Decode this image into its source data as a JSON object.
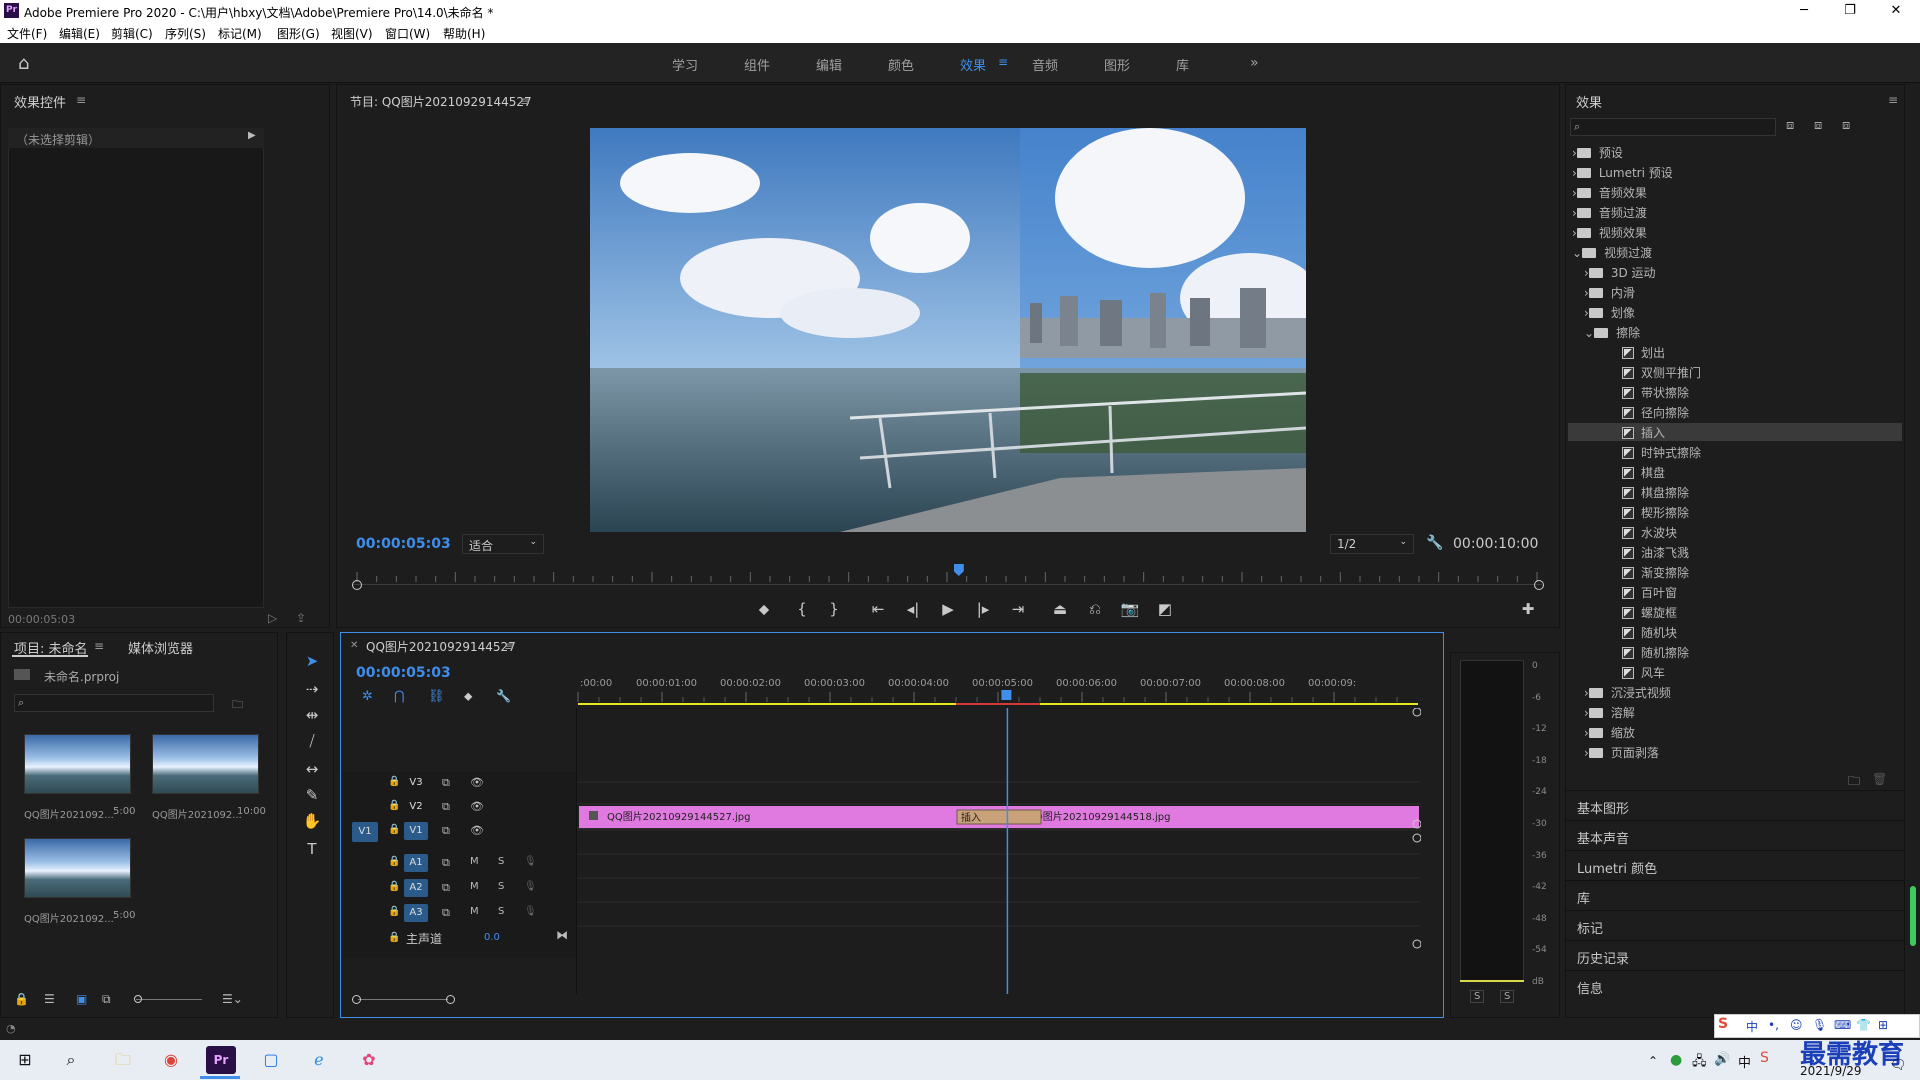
{
  "window": {
    "title": "Adobe Premiere Pro 2020 - C:\\用户\\hbxy\\文档\\Adobe\\Premiere Pro\\14.0\\未命名 *",
    "logo": "Pr"
  },
  "menu": [
    "文件(F)",
    "编辑(E)",
    "剪辑(C)",
    "序列(S)",
    "标记(M)",
    "图形(G)",
    "视图(V)",
    "窗口(W)",
    "帮助(H)"
  ],
  "workspaces": [
    "学习",
    "组件",
    "编辑",
    "颜色",
    "效果",
    "音频",
    "图形",
    "库"
  ],
  "active_workspace": "效果",
  "effect_controls": {
    "title": "效果控件",
    "placeholder": "（未选择剪辑）",
    "timecode": "00:00:05:03"
  },
  "program": {
    "title": "节目: QQ图片20210929144527",
    "timecode": "00:00:05:03",
    "fit": "适合",
    "resolution": "1/2",
    "duration": "00:00:10:00",
    "playhead_fraction": 0.51
  },
  "project": {
    "tab1": "项目: 未命名",
    "tab2": "媒体浏览器",
    "file": "未命名.prproj",
    "items": [
      {
        "label": "QQ图片2021092...",
        "duration": "5:00"
      },
      {
        "label": "QQ图片2021092...",
        "duration": "10:00"
      },
      {
        "label": "QQ图片2021092...",
        "duration": "5:00"
      }
    ]
  },
  "timeline": {
    "tab": "QQ图片20210929144527",
    "timecode": "00:00:05:03",
    "ruler": [
      ":00:00",
      "00:00:01:00",
      "00:00:02:00",
      "00:00:03:00",
      "00:00:04:00",
      "00:00:05:00",
      "00:00:06:00",
      "00:00:07:00",
      "00:00:08:00",
      "00:00:09:"
    ],
    "video_tracks": [
      "V3",
      "V2",
      "V1"
    ],
    "audio_tracks": [
      "A1",
      "A2",
      "A3"
    ],
    "src_patch": "V1",
    "master": {
      "label": "主声道",
      "value": "0.0"
    },
    "track_buttons": {
      "mute": "M",
      "solo": "S"
    },
    "clips": [
      {
        "name": "QQ图片20210929144527.jpg",
        "start": 0,
        "end": 5
      },
      {
        "name": "QQ图片20210929144518.jpg",
        "start": 5,
        "end": 10
      }
    ],
    "transition": {
      "name": "插入",
      "start": 4.5,
      "end": 5.5
    },
    "playhead_seconds": 5.1,
    "duration_seconds": 10
  },
  "effects": {
    "title": "效果",
    "tree": [
      {
        "label": "预设",
        "type": "folder",
        "level": 0,
        "open": false
      },
      {
        "label": "Lumetri 预设",
        "type": "folder",
        "level": 0,
        "open": false
      },
      {
        "label": "音频效果",
        "type": "folder",
        "level": 0,
        "open": false
      },
      {
        "label": "音频过渡",
        "type": "folder",
        "level": 0,
        "open": false
      },
      {
        "label": "视频效果",
        "type": "folder",
        "level": 0,
        "open": false
      },
      {
        "label": "视频过渡",
        "type": "folder",
        "level": 0,
        "open": true
      },
      {
        "label": "3D 运动",
        "type": "folder",
        "level": 1,
        "open": false
      },
      {
        "label": "内滑",
        "type": "folder",
        "level": 1,
        "open": false
      },
      {
        "label": "划像",
        "type": "folder",
        "level": 1,
        "open": false
      },
      {
        "label": "擦除",
        "type": "folder",
        "level": 1,
        "open": true
      },
      {
        "label": "划出",
        "type": "fx",
        "level": 2
      },
      {
        "label": "双侧平推门",
        "type": "fx",
        "level": 2
      },
      {
        "label": "带状擦除",
        "type": "fx",
        "level": 2
      },
      {
        "label": "径向擦除",
        "type": "fx",
        "level": 2
      },
      {
        "label": "插入",
        "type": "fx",
        "level": 2,
        "selected": true
      },
      {
        "label": "时钟式擦除",
        "type": "fx",
        "level": 2
      },
      {
        "label": "棋盘",
        "type": "fx",
        "level": 2
      },
      {
        "label": "棋盘擦除",
        "type": "fx",
        "level": 2
      },
      {
        "label": "楔形擦除",
        "type": "fx",
        "level": 2
      },
      {
        "label": "水波块",
        "type": "fx",
        "level": 2
      },
      {
        "label": "油漆飞溅",
        "type": "fx",
        "level": 2
      },
      {
        "label": "渐变擦除",
        "type": "fx",
        "level": 2
      },
      {
        "label": "百叶窗",
        "type": "fx",
        "level": 2
      },
      {
        "label": "螺旋框",
        "type": "fx",
        "level": 2
      },
      {
        "label": "随机块",
        "type": "fx",
        "level": 2
      },
      {
        "label": "随机擦除",
        "type": "fx",
        "level": 2
      },
      {
        "label": "风车",
        "type": "fx",
        "level": 2
      },
      {
        "label": "沉浸式视频",
        "type": "folder",
        "level": 1,
        "open": false
      },
      {
        "label": "溶解",
        "type": "folder",
        "level": 1,
        "open": false
      },
      {
        "label": "缩放",
        "type": "folder",
        "level": 1,
        "open": false
      },
      {
        "label": "页面剥落",
        "type": "folder",
        "level": 1,
        "open": false
      }
    ],
    "sections": [
      "基本图形",
      "基本声音",
      "Lumetri 颜色",
      "库",
      "标记",
      "历史记录",
      "信息"
    ]
  },
  "audio_meter": {
    "scale": [
      "0",
      "-6",
      "-12",
      "-18",
      "-24",
      "-30",
      "-36",
      "-42",
      "-48",
      "-54",
      "dB"
    ],
    "solo": "S"
  },
  "taskbar": {
    "date": "2021/9/29",
    "brand": "最需教育",
    "ime": "中"
  },
  "colors": {
    "accent": "#3e8eea",
    "clip": "#e07ae0",
    "transition": "#c9a27a",
    "workarea": "#e8e821"
  }
}
